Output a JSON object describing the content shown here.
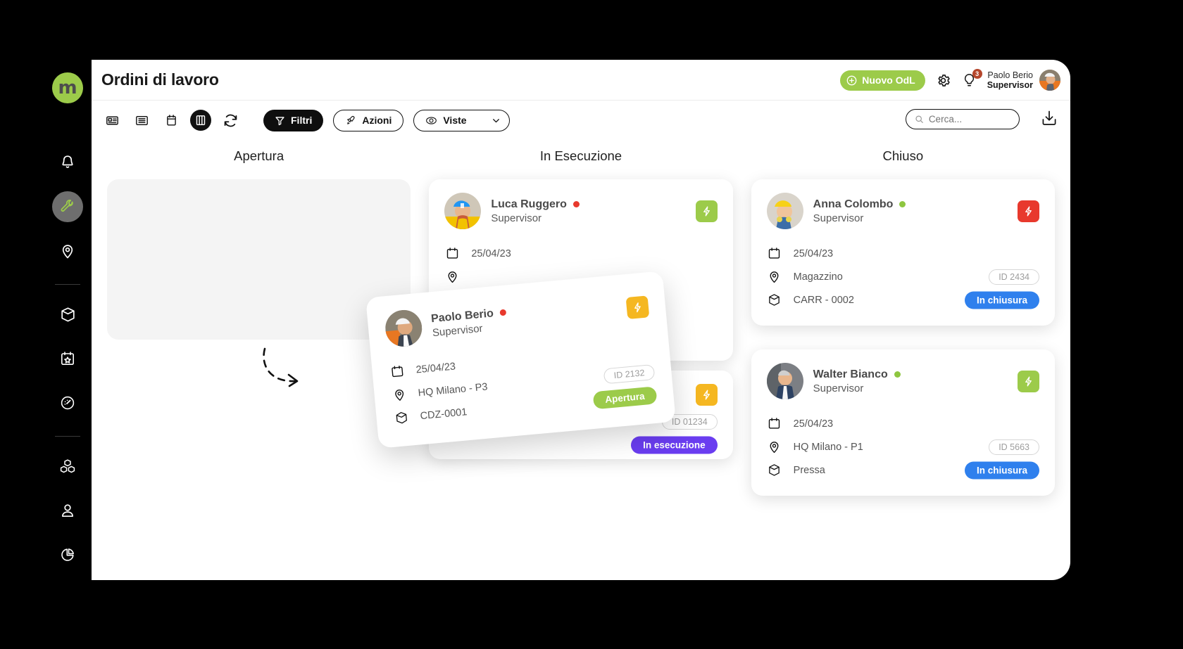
{
  "app": {
    "logo_text": "m",
    "accent_green": "#9ccb4a",
    "accent_blue": "#2f80ed",
    "accent_purple": "#6a3df0",
    "accent_red": "#e8392d",
    "accent_yellow": "#f5b721"
  },
  "sidebar": {
    "items": [
      {
        "name": "notifications",
        "icon": "bell-icon",
        "active": false
      },
      {
        "name": "maintenance",
        "icon": "wrench-icon",
        "active": true
      },
      {
        "name": "locations",
        "icon": "location-pin-icon",
        "active": false
      },
      {
        "name": "assets",
        "icon": "box-icon",
        "active": false
      },
      {
        "name": "planning",
        "icon": "calendar-star-icon",
        "active": false
      },
      {
        "name": "performance",
        "icon": "gauge-icon",
        "active": false
      },
      {
        "name": "inventory",
        "icon": "cubes-icon",
        "active": false
      },
      {
        "name": "users",
        "icon": "person-icon",
        "active": false
      },
      {
        "name": "reports",
        "icon": "pie-chart-icon",
        "active": false
      }
    ]
  },
  "header": {
    "title": "Ordini di lavoro",
    "new_button": "Nuovo OdL",
    "settings_icon": "gear-icon",
    "tips_icon": "lightbulb-icon",
    "tips_badge": "3",
    "user_name": "Paolo Berio",
    "user_role": "Supervisor"
  },
  "toolbar": {
    "view_icons": [
      {
        "name": "card-view-icon"
      },
      {
        "name": "list-view-icon"
      },
      {
        "name": "calendar-view-icon"
      },
      {
        "name": "kanban-view-icon"
      },
      {
        "name": "refresh-icon"
      }
    ],
    "filters_label": "Filtri",
    "actions_label": "Azioni",
    "views_label": "Viste",
    "search_placeholder": "Cerca...",
    "search_value": "",
    "download_icon": "download-icon"
  },
  "board": {
    "columns": [
      {
        "title": "Apertura",
        "cards": []
      },
      {
        "title": "In Esecuzione",
        "cards": [
          {
            "name": "Luca Ruggero",
            "role": "Supervisor",
            "status_dot": "#e8392d",
            "bolt_color": "#9ccb4a",
            "date": "25/04/23",
            "location": "",
            "asset": "",
            "id": "",
            "status": "",
            "status_color": ""
          },
          {
            "name": "",
            "role": "",
            "status_dot": "",
            "bolt_color": "#f5b721",
            "date": "",
            "location": "",
            "asset": "",
            "id": "ID 01234",
            "status": "In esecuzione",
            "status_color": "#6a3df0"
          }
        ]
      },
      {
        "title": "Chiuso",
        "cards": [
          {
            "name": "Anna Colombo",
            "role": "Supervisor",
            "status_dot": "#8ec640",
            "bolt_color": "#e8392d",
            "date": "25/04/23",
            "location": "Magazzino",
            "asset": "CARR - 0002",
            "id": "ID 2434",
            "status": "In chiusura",
            "status_color": "#2f80ed"
          },
          {
            "name": "Walter Bianco",
            "role": "Supervisor",
            "status_dot": "#8ec640",
            "bolt_color": "#9ccb4a",
            "date": "25/04/23",
            "location": "HQ Milano - P1",
            "asset": "Pressa",
            "id": "ID 5663",
            "status": "In chiusura",
            "status_color": "#2f80ed"
          }
        ]
      }
    ],
    "drag_card": {
      "name": "Paolo Berio",
      "role": "Supervisor",
      "status_dot": "#e8392d",
      "bolt_color": "#f5b721",
      "date": "25/04/23",
      "location": "HQ Milano - P3",
      "asset": "CDZ-0001",
      "id": "ID 2132",
      "status": "Apertura",
      "status_color": "#9ccb4a"
    }
  }
}
